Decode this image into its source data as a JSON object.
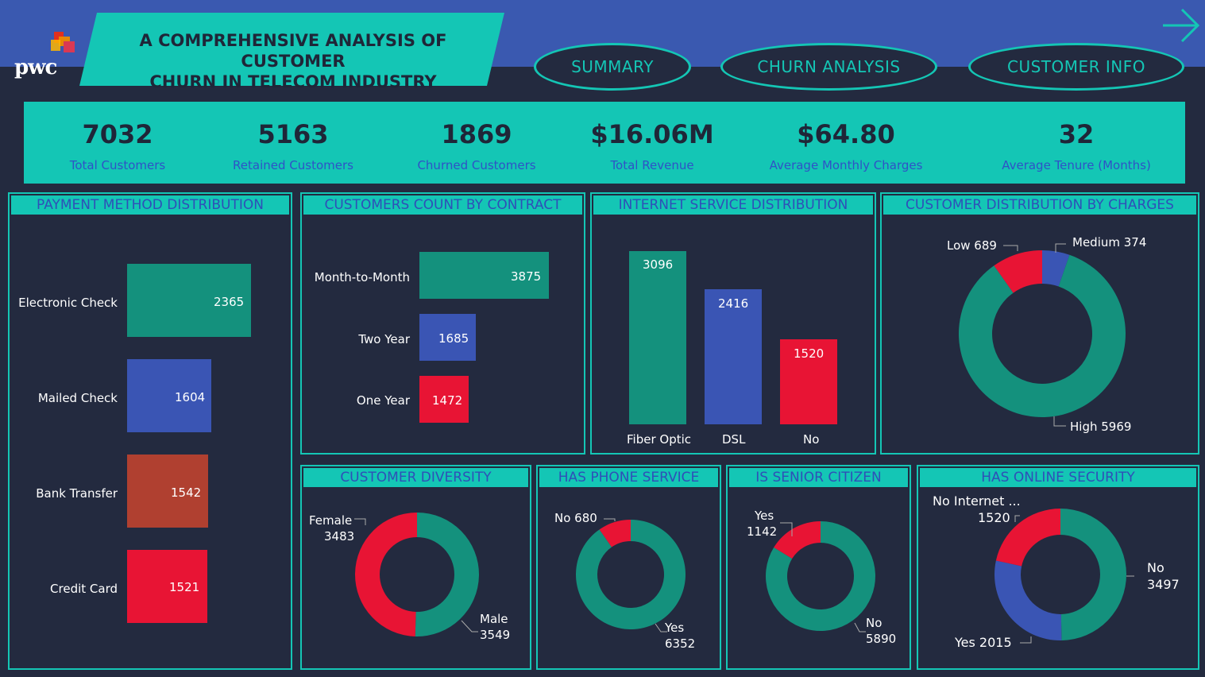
{
  "header": {
    "logo_text": "pwc",
    "title_line1": "A COMPREHENSIVE ANALYSIS OF CUSTOMER",
    "title_line2": "CHURN IN TELECOM INDUSTRY",
    "nav": [
      "SUMMARY",
      "CHURN ANALYSIS",
      "CUSTOMER INFO"
    ],
    "next_icon": "arrow-right-icon"
  },
  "kpis": [
    {
      "value": "7032",
      "label": "Total Customers"
    },
    {
      "value": "5163",
      "label": "Retained Customers"
    },
    {
      "value": "1869",
      "label": "Churned Customers"
    },
    {
      "value": "$16.06M",
      "label": "Total Revenue"
    },
    {
      "value": "$64.80",
      "label": "Average Monthly Charges"
    },
    {
      "value": "32",
      "label": "Average Tenure (Months)"
    }
  ],
  "colors": {
    "teal": "#14c6b5",
    "green": "#14917d",
    "blue": "#3a55b4",
    "red": "#e81434",
    "brown": "#b04030",
    "bg": "#232a3f"
  },
  "panels": {
    "payment": {
      "title": "PAYMENT METHOD DISTRIBUTION",
      "items": [
        {
          "label": "Electronic Check",
          "value": "2365"
        },
        {
          "label": "Mailed Check",
          "value": "1604"
        },
        {
          "label": "Bank Transfer",
          "value": "1542"
        },
        {
          "label": "Credit Card",
          "value": "1521"
        }
      ]
    },
    "contract": {
      "title": "CUSTOMERS COUNT BY CONTRACT",
      "items": [
        {
          "label": "Month-to-Month",
          "value": "3875"
        },
        {
          "label": "Two Year",
          "value": "1685"
        },
        {
          "label": "One Year",
          "value": "1472"
        }
      ]
    },
    "internet": {
      "title": "INTERNET SERVICE DISTRIBUTION",
      "items": [
        {
          "label": "Fiber Optic",
          "value": "3096"
        },
        {
          "label": "DSL",
          "value": "2416"
        },
        {
          "label": "No",
          "value": "1520"
        }
      ]
    },
    "charges": {
      "title": "CUSTOMER DISTRIBUTION BY CHARGES",
      "low": "Low 689",
      "medium": "Medium 374",
      "high": "High 5969"
    },
    "diversity": {
      "title": "CUSTOMER DIVERSITY",
      "female_label": "Female",
      "female_value": "3483",
      "male_label": "Male",
      "male_value": "3549"
    },
    "phone": {
      "title": "HAS PHONE SERVICE",
      "no_label": "No 680",
      "yes_label": "Yes",
      "yes_value": "6352"
    },
    "senior": {
      "title": "IS SENIOR CITIZEN",
      "yes_label": "Yes",
      "yes_value": "1142",
      "no_label": "No",
      "no_value": "5890"
    },
    "security": {
      "title": "HAS ONLINE SECURITY",
      "ni_label": "No Internet ...",
      "ni_value": "1520",
      "no_label": "No",
      "no_value": "3497",
      "yes_label": "Yes 2015"
    }
  },
  "chart_data": [
    {
      "type": "bar",
      "title": "PAYMENT METHOD DISTRIBUTION",
      "categories": [
        "Electronic Check",
        "Mailed Check",
        "Bank Transfer",
        "Credit Card"
      ],
      "values": [
        2365,
        1604,
        1542,
        1521
      ]
    },
    {
      "type": "bar",
      "title": "CUSTOMERS COUNT BY CONTRACT",
      "categories": [
        "Month-to-Month",
        "Two Year",
        "One Year"
      ],
      "values": [
        3875,
        1685,
        1472
      ]
    },
    {
      "type": "bar",
      "title": "INTERNET SERVICE DISTRIBUTION",
      "categories": [
        "Fiber Optic",
        "DSL",
        "No"
      ],
      "values": [
        3096,
        2416,
        1520
      ]
    },
    {
      "type": "pie",
      "title": "CUSTOMER DISTRIBUTION BY CHARGES",
      "categories": [
        "Medium",
        "High",
        "Low"
      ],
      "values": [
        374,
        5969,
        689
      ]
    },
    {
      "type": "pie",
      "title": "CUSTOMER DIVERSITY",
      "categories": [
        "Male",
        "Female"
      ],
      "values": [
        3549,
        3483
      ]
    },
    {
      "type": "pie",
      "title": "HAS PHONE SERVICE",
      "categories": [
        "Yes",
        "No"
      ],
      "values": [
        6352,
        680
      ]
    },
    {
      "type": "pie",
      "title": "IS SENIOR CITIZEN",
      "categories": [
        "No",
        "Yes"
      ],
      "values": [
        5890,
        1142
      ]
    },
    {
      "type": "pie",
      "title": "HAS ONLINE SECURITY",
      "categories": [
        "No",
        "Yes",
        "No Internet ..."
      ],
      "values": [
        3497,
        2015,
        1520
      ]
    }
  ]
}
